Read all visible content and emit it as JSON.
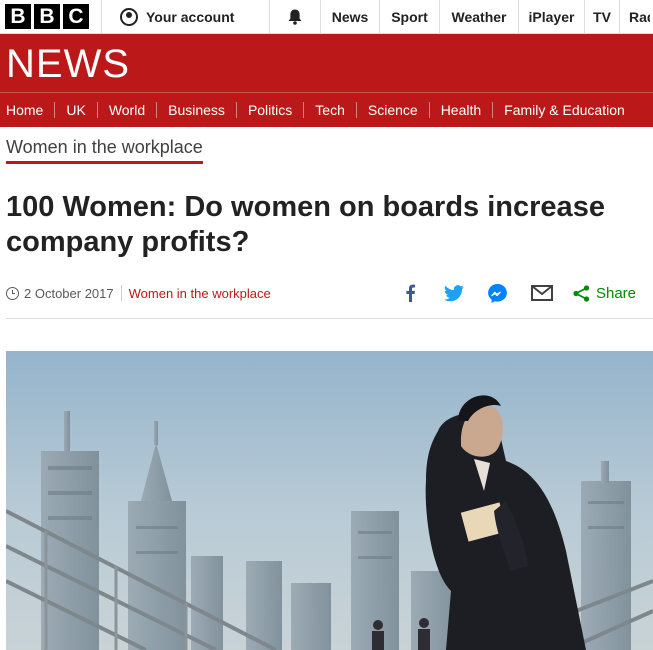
{
  "topbar": {
    "logo_letters": [
      "B",
      "B",
      "C"
    ],
    "account_label": "Your account",
    "links": [
      "News",
      "Sport",
      "Weather",
      "iPlayer",
      "TV",
      "Radio"
    ]
  },
  "header": {
    "brand": "NEWS",
    "nav": [
      "Home",
      "UK",
      "World",
      "Business",
      "Politics",
      "Tech",
      "Science",
      "Health",
      "Family & Education"
    ]
  },
  "article": {
    "section": "Women in the workplace",
    "headline": "100 Women: Do women on boards increase company profits?",
    "date": "2 October 2017",
    "meta_section": "Women in the workplace",
    "share_label": "Share",
    "share_icons": [
      "facebook-icon",
      "twitter-icon",
      "messenger-icon",
      "email-icon",
      "share-icon"
    ]
  },
  "colors": {
    "brand_red": "#bb1919",
    "facebook": "#3b5998",
    "twitter": "#1da1f2",
    "messenger": "#0084ff",
    "share_green": "#008a00"
  }
}
